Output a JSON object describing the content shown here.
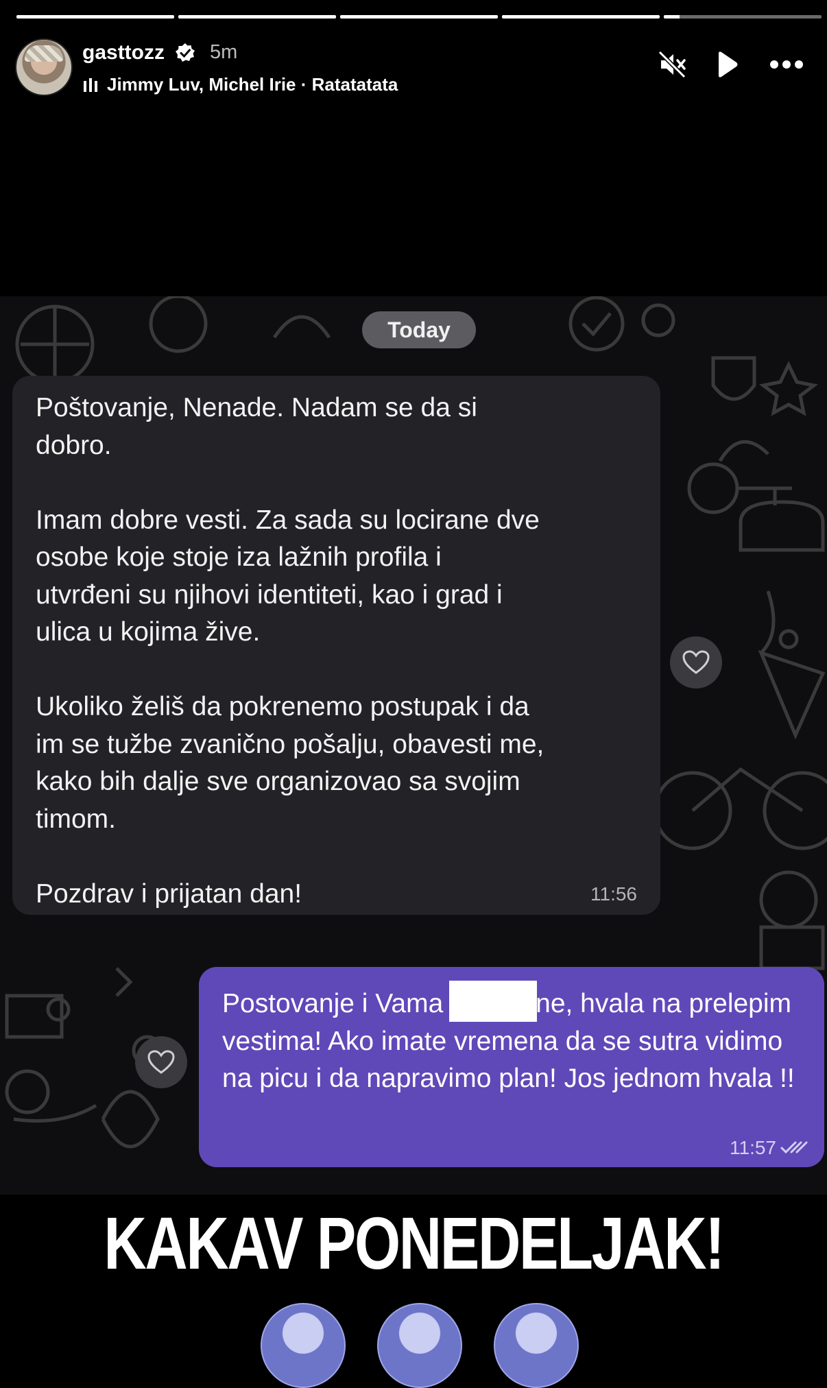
{
  "story": {
    "progress": [
      1,
      1,
      1,
      1,
      0.1
    ]
  },
  "header": {
    "username": "gasttozz",
    "time_ago": "5m",
    "music": "Jimmy Luv, Michel Irie · Ratatatata",
    "icons": [
      "muted-speaker-icon",
      "play-icon",
      "more-icon"
    ]
  },
  "chat": {
    "date_label": "Today",
    "incoming": {
      "text": "Poštovanje, Nenade. Nadam se da si\ndobro.\n\nImam dobre vesti. Za sada su locirane dve\nosobe koje stoje iza lažnih profila i\nutvrđeni su njihovi identiteti, kao i grad i\nulica u kojima žive.\n\nUkoliko želiš da pokrenemo postupak i da\nim se tužbe zvanično pošalju, obavesti me,\nkako bih dalje sve organizovao sa svojim\ntimom.\n\nPozdrav i prijatan dan!",
      "time": "11:56"
    },
    "outgoing": {
      "text_before": "Postovanje i Vama ",
      "text_after": "ne, hvala na prelepim vestima! Ako imate vremena da se sutra vidimo na picu i da napravimo plan! Jos jednom hvala !!",
      "time": "11:57"
    }
  },
  "caption": "KAKAV PONEDELJAK!",
  "colors": {
    "incoming_bubble": "#222227",
    "outgoing_bubble": "#5f49b8"
  }
}
